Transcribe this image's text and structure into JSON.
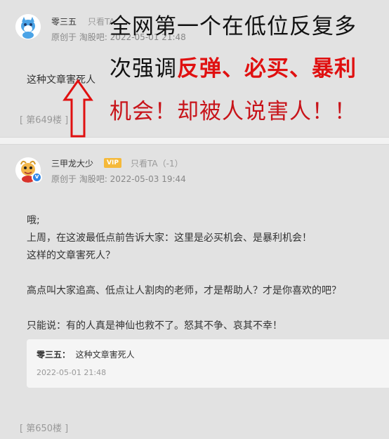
{
  "post1": {
    "username": "零三五",
    "only_ta": "只看TA",
    "meta": "原创于 淘股吧: 2022-05-01 21:48",
    "body": "这种文章害死人",
    "floor": "[ 第649楼 ]"
  },
  "post2": {
    "username": "三甲龙大少",
    "vip_badge": "VIP",
    "only_ta": "只看TA（-1）",
    "meta": "原创于 淘股吧: 2022-05-03 19:44",
    "lines": [
      "哦;",
      "上周，在这波最低点前告诉大家：这里是必买机会、是暴利机会！",
      "这样的文章害死人？",
      "高点叫大家追高、低点让人割肉的老师，才是帮助人？才是你喜欢的吧？",
      "只能说：有的人真是神仙也救不了。怒其不争、哀其不幸！"
    ],
    "quote": {
      "author": "零三五：",
      "text": "这种文章害死人",
      "time": "2022-05-01 21:48"
    },
    "floor": "[ 第650楼 ]"
  },
  "overlay": {
    "line1": "全网第一个在低位反复多",
    "line2_prefix": "次强调",
    "line2_red": "反弹、必买、暴利",
    "line3": "机会！却被人说害人！！"
  },
  "colors": {
    "overlay_red": "#e01010",
    "overlay_dark_red": "#c8141a",
    "annotation_arrow": "#e01010",
    "vip": "#f5b93a",
    "verified": "#2f86e8"
  }
}
